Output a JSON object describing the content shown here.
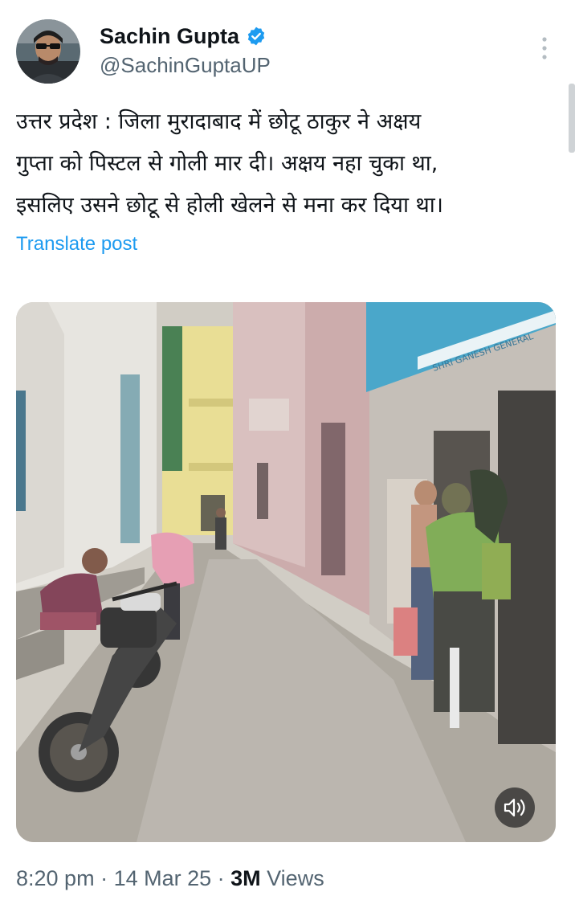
{
  "author": {
    "display_name": "Sachin Gupta",
    "handle": "@SachinGuptaUP",
    "verified": true,
    "avatar_icon": "profile-photo"
  },
  "tweet": {
    "lines": [
      "उत्तर प्रदेश : जिला मुरादाबाद में छोटू ठाकुर ने अक्षय",
      "गुप्ता को पिस्टल से गोली मार दी। अक्षय नहा चुका था,",
      "इसलिए उसने छोटू से होली खेलने से मना कर दिया था।"
    ],
    "translate_label": "Translate post"
  },
  "media": {
    "shop_sign_text": "SHRI GANESH GENERAL",
    "mute_icon": "speaker-muted-icon"
  },
  "meta": {
    "time": "8:20 pm",
    "separator": " · ",
    "date": "14 Mar 25",
    "views_count": "3M",
    "views_label": " Views"
  },
  "colors": {
    "text_primary": "#0f1419",
    "text_secondary": "#536471",
    "link_blue": "#1d9bf0",
    "verified_blue": "#1d9bf0"
  }
}
